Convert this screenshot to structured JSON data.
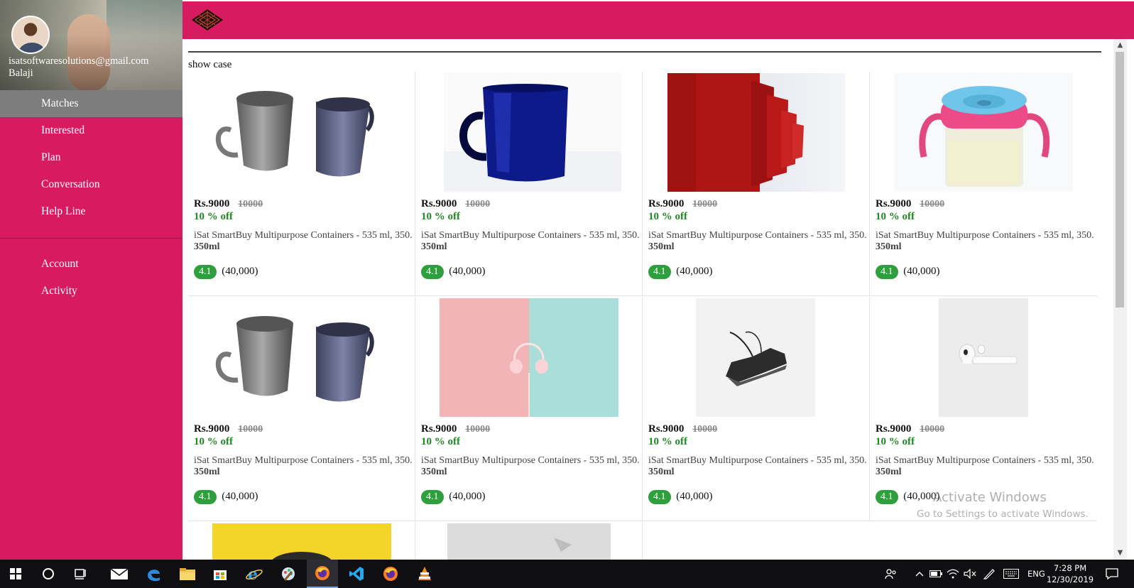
{
  "profile": {
    "email": "isatsoftwaresolutions@gmail.com",
    "name": "Balaji"
  },
  "sidebar": {
    "items": [
      {
        "label": "Matches",
        "active": true
      },
      {
        "label": "Interested"
      },
      {
        "label": "Plan"
      },
      {
        "label": "Conversation"
      },
      {
        "label": "Help Line"
      }
    ],
    "secondary": [
      {
        "label": "Account"
      },
      {
        "label": "Activity"
      }
    ]
  },
  "colors": {
    "brand": "#d81b60",
    "active_nav": "#7d7d7d",
    "discount": "#1f8a21",
    "rating": "#2e9f3d"
  },
  "main": {
    "section_title": "show case",
    "products": [
      {
        "image": "grey-and-blue-mugs",
        "price": "Rs.9000",
        "mrp": "10000",
        "discount": "10 % off",
        "title": "iSat SmartBuy Multipurpose Containers - 535 ml, 350.",
        "subtitle": "350ml",
        "rating": "4.1",
        "reviews": "(40,000)"
      },
      {
        "image": "navy-glass-mug",
        "price": "Rs.9000",
        "mrp": "10000",
        "discount": "10 % off",
        "title": "iSat SmartBuy Multipurpose Containers - 535 ml, 350.",
        "subtitle": "350ml",
        "rating": "4.1",
        "reviews": "(40,000)"
      },
      {
        "image": "red-mugs-row",
        "price": "Rs.9000",
        "mrp": "10000",
        "discount": "10 % off",
        "title": "iSat SmartBuy Multipurpose Containers - 535 ml, 350.",
        "subtitle": "350ml",
        "rating": "4.1",
        "reviews": "(40,000)"
      },
      {
        "image": "pink-sippy-cup",
        "price": "Rs.9000",
        "mrp": "10000",
        "discount": "10 % off",
        "title": "iSat SmartBuy Multipurpose Containers - 535 ml, 350.",
        "subtitle": "350ml",
        "rating": "4.1",
        "reviews": "(40,000)"
      },
      {
        "image": "grey-and-blue-mugs",
        "price": "Rs.9000",
        "mrp": "10000",
        "discount": "10 % off",
        "title": "iSat SmartBuy Multipurpose Containers - 535 ml, 350.",
        "subtitle": "350ml",
        "rating": "4.1",
        "reviews": "(40,000)"
      },
      {
        "image": "headphones-pastel",
        "price": "Rs.9000",
        "mrp": "10000",
        "discount": "10 % off",
        "title": "iSat SmartBuy Multipurpose Containers - 535 ml, 350.",
        "subtitle": "350ml",
        "rating": "4.1",
        "reviews": "(40,000)"
      },
      {
        "image": "black-sneaker",
        "price": "Rs.9000",
        "mrp": "10000",
        "discount": "10 % off",
        "title": "iSat SmartBuy Multipurpose Containers - 535 ml, 350.",
        "subtitle": "350ml",
        "rating": "4.1",
        "reviews": "(40,000)"
      },
      {
        "image": "white-earbuds",
        "price": "Rs.9000",
        "mrp": "10000",
        "discount": "10 % off",
        "title": "iSat SmartBuy Multipurpose Containers - 535 ml, 350.",
        "subtitle": "350ml",
        "rating": "4.1",
        "reviews": "(40,000)"
      }
    ]
  },
  "watermark": {
    "line1": "Activate Windows",
    "line2": "Go to Settings to activate Windows."
  },
  "taskbar": {
    "language": "ENG",
    "time": "7:28 PM",
    "date": "12/30/2019"
  }
}
